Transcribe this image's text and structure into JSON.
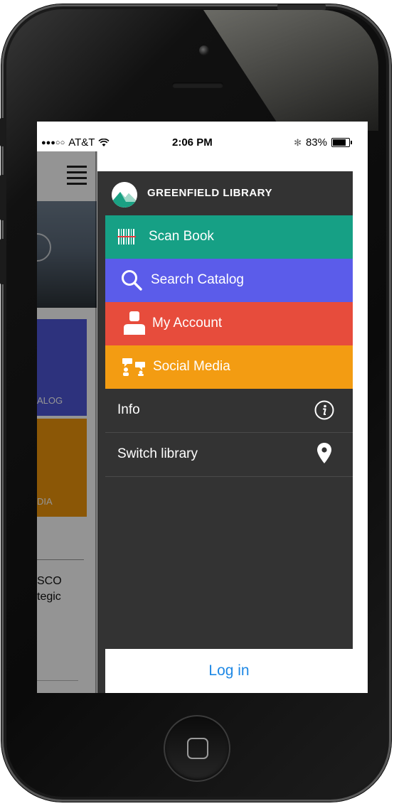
{
  "status_bar": {
    "signal": "●●●○○",
    "carrier": "AT&T",
    "wifi_icon": "wifi-icon",
    "time": "2:06 PM",
    "bluetooth": "✻",
    "battery": "83%"
  },
  "background_app": {
    "tile_blue_label": "ALOG",
    "tile_orange_label": "DIA",
    "text_line_1": "SCO",
    "text_line_2": "tegic"
  },
  "drawer": {
    "brand": {
      "title": "GREENFIELD LIBRARY",
      "logo_icon": "mountain-logo-icon"
    },
    "menu": [
      {
        "label": "Scan Book",
        "icon": "barcode-icon",
        "color": "#16a085"
      },
      {
        "label": "Search Catalog",
        "icon": "search-icon",
        "color": "#5b5cea"
      },
      {
        "label": "My Account",
        "icon": "user-icon",
        "color": "#e74c3c"
      },
      {
        "label": "Social Media",
        "icon": "social-icon",
        "color": "#f39c12"
      }
    ],
    "rows": [
      {
        "label": "Info",
        "icon": "info-icon"
      },
      {
        "label": "Switch library",
        "icon": "location-pin-icon"
      }
    ],
    "login": {
      "label": "Log in"
    }
  },
  "colors": {
    "drawer_bg": "#333333",
    "login_text": "#1e88e5"
  }
}
